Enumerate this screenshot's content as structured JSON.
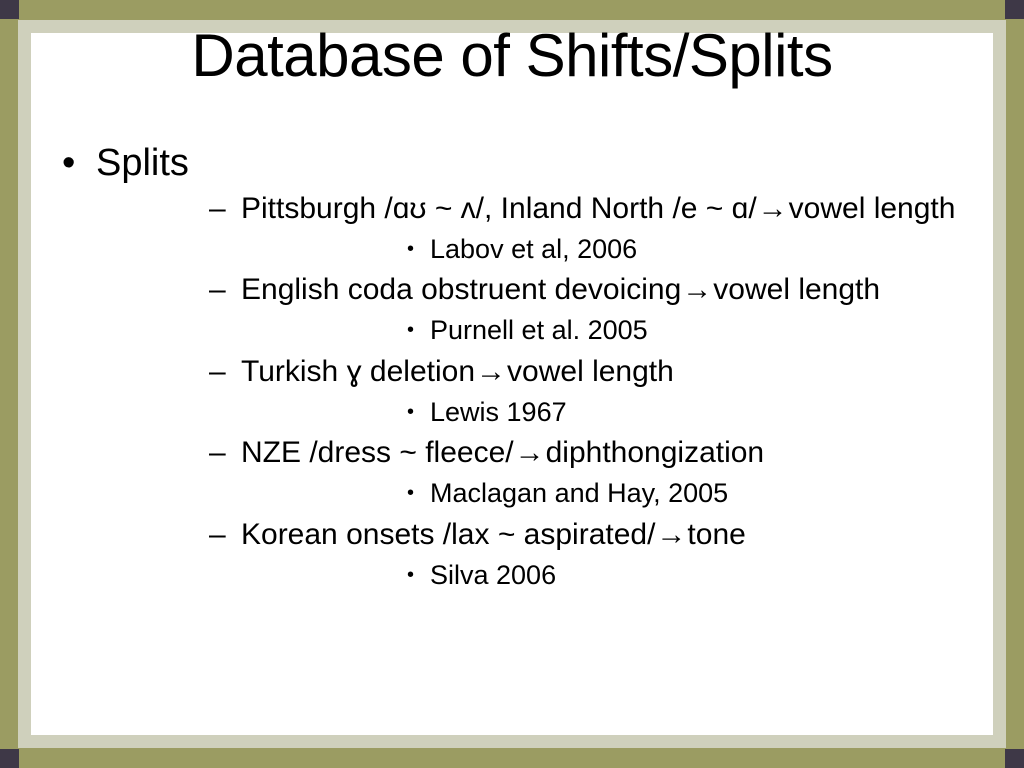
{
  "slide": {
    "title": "Database of Shifts/Splits",
    "theme": {
      "outer_frame_color": "#9B9C62",
      "inner_band_color": "#CFD0BC",
      "corner_accent_color": "#3E3847",
      "canvas_color": "#FFFFFF",
      "text_color": "#000000"
    },
    "bullet_glyphs": {
      "level1": "•",
      "level2": "–",
      "level3": "•",
      "arrow": "→"
    },
    "content": {
      "heading": "Splits",
      "entries": [
        {
          "change": "Pittsburgh /ɑʊ ~ ʌ/, Inland North /e ~ ɑ/",
          "arrow": "→",
          "outcome": "vowel length",
          "citation": "Labov et al, 2006"
        },
        {
          "change": "English coda obstruent devoicing",
          "arrow": "→",
          "outcome": "vowel length",
          "citation": "Purnell et al. 2005"
        },
        {
          "change": "Turkish ɣ deletion",
          "arrow": "→",
          "outcome": "vowel length",
          "citation": "Lewis 1967"
        },
        {
          "change": "NZE /dress ~ fleece/",
          "arrow": "→",
          "outcome": "diphthongization",
          "citation": "Maclagan and Hay, 2005"
        },
        {
          "change": "Korean onsets /lax ~ aspirated/",
          "arrow": "→",
          "outcome": "tone",
          "citation": "Silva 2006"
        }
      ]
    }
  }
}
